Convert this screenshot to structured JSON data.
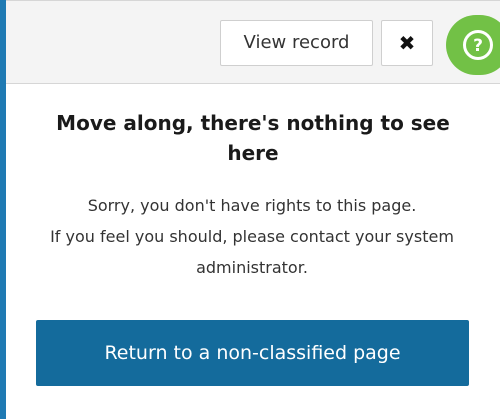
{
  "toolbar": {
    "view_record_label": "View record",
    "close_glyph": "✖",
    "help_glyph": "?"
  },
  "notice": {
    "heading_line1": "Move along, there's nothing to see",
    "heading_line2": "here",
    "message_line1": "Sorry, you don't have rights to this page.",
    "message_line2": "If you feel you should, please contact your system",
    "message_line3": "administrator."
  },
  "actions": {
    "return_label": "Return to a non-classified page"
  },
  "colors": {
    "accent": "#1f7ab3",
    "primary_button": "#146b9c",
    "help": "#72c146"
  },
  "icons": {
    "close": "close-icon",
    "help": "help-question-icon"
  }
}
